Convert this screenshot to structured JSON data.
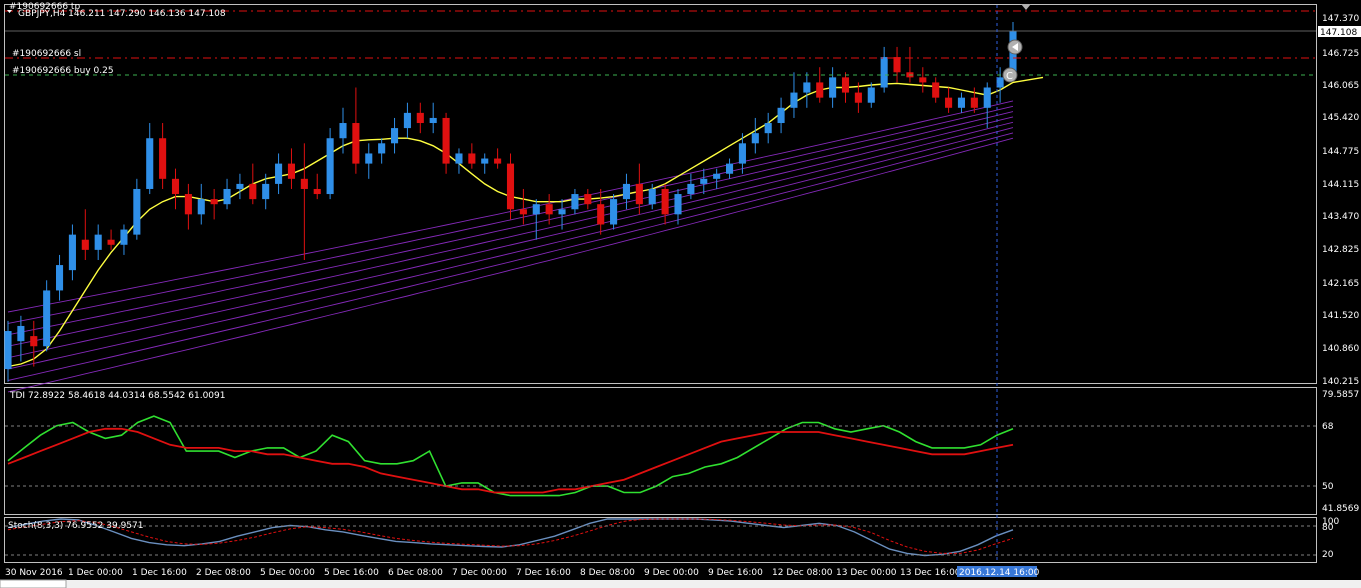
{
  "header": {
    "symbol_line": "GBPJPY,H4  146.211 147.290 146.136 147.108",
    "order_tp": "#190692666 tp",
    "order_sl": "#190692666 sl",
    "order_buy": "#190692666 buy 0.25"
  },
  "main_panel": {
    "price_ticks": [
      "147.370",
      "146.725",
      "146.065",
      "145.420",
      "144.775",
      "144.115",
      "143.470",
      "142.825",
      "142.165",
      "141.520",
      "140.860",
      "140.215"
    ],
    "current_price_label": "147.108"
  },
  "tdi_panel": {
    "label": "TDI 72.8922 58.4618 44.0314 68.5542 61.0091",
    "ticks": [
      "79.5857",
      "68",
      "50",
      "41.8569"
    ]
  },
  "stoch_panel": {
    "label": "Stoch(8,3,3) 76.9552 39.9571",
    "ticks": [
      "100",
      "80",
      "20"
    ]
  },
  "time_axis": {
    "labels": [
      "30 Nov 2016",
      "1 Dec 00:00",
      "1 Dec 16:00",
      "2 Dec 08:00",
      "5 Dec 00:00",
      "5 Dec 16:00",
      "6 Dec 08:00",
      "7 Dec 00:00",
      "7 Dec 16:00",
      "8 Dec 08:00",
      "9 Dec 00:00",
      "9 Dec 16:00",
      "12 Dec 08:00",
      "13 Dec 00:00",
      "13 Dec 16:00"
    ],
    "crosshair_label": "2016.12.14 16:00"
  },
  "colors": {
    "bull": "#2f8fe8",
    "bear": "#e01010",
    "ema": "#ffff40",
    "bands": "#9b30d8",
    "tdi_green": "#30e030",
    "tdi_red": "#e01010",
    "stoch_main": "#6a8fbf",
    "stoch_signal": "#e01010",
    "sl_line": "#e01010",
    "entry_line": "#3cb050"
  },
  "chart_data": {
    "type": "candlestick",
    "symbol": "GBPJPY",
    "timeframe": "H4",
    "ylim": [
      140.215,
      147.6
    ],
    "open_last": 146.211,
    "high_last": 147.29,
    "low_last": 146.136,
    "close_last": 147.108,
    "sl_price": 146.62,
    "entry_price": 146.2,
    "candles": [
      {
        "o": 140.45,
        "h": 141.4,
        "l": 140.2,
        "c": 141.2
      },
      {
        "o": 141.0,
        "h": 141.5,
        "l": 140.6,
        "c": 141.3
      },
      {
        "o": 141.1,
        "h": 141.4,
        "l": 140.5,
        "c": 140.9
      },
      {
        "o": 140.9,
        "h": 142.2,
        "l": 140.8,
        "c": 142.0
      },
      {
        "o": 142.0,
        "h": 142.7,
        "l": 141.8,
        "c": 142.5
      },
      {
        "o": 142.4,
        "h": 143.3,
        "l": 142.2,
        "c": 143.1
      },
      {
        "o": 143.0,
        "h": 143.6,
        "l": 142.6,
        "c": 142.8
      },
      {
        "o": 142.8,
        "h": 143.3,
        "l": 142.6,
        "c": 143.1
      },
      {
        "o": 143.0,
        "h": 143.2,
        "l": 142.8,
        "c": 142.9
      },
      {
        "o": 142.9,
        "h": 143.3,
        "l": 142.7,
        "c": 143.2
      },
      {
        "o": 143.1,
        "h": 144.2,
        "l": 143.0,
        "c": 144.0
      },
      {
        "o": 144.0,
        "h": 145.3,
        "l": 143.9,
        "c": 145.0
      },
      {
        "o": 145.0,
        "h": 145.3,
        "l": 144.0,
        "c": 144.2
      },
      {
        "o": 144.2,
        "h": 144.4,
        "l": 143.6,
        "c": 143.9
      },
      {
        "o": 143.9,
        "h": 144.1,
        "l": 143.2,
        "c": 143.5
      },
      {
        "o": 143.5,
        "h": 144.1,
        "l": 143.3,
        "c": 143.8
      },
      {
        "o": 143.8,
        "h": 144.0,
        "l": 143.4,
        "c": 143.7
      },
      {
        "o": 143.7,
        "h": 144.2,
        "l": 143.6,
        "c": 144.0
      },
      {
        "o": 144.0,
        "h": 144.3,
        "l": 143.8,
        "c": 144.1
      },
      {
        "o": 144.1,
        "h": 144.5,
        "l": 143.7,
        "c": 143.8
      },
      {
        "o": 143.8,
        "h": 144.3,
        "l": 143.6,
        "c": 144.1
      },
      {
        "o": 144.1,
        "h": 144.7,
        "l": 143.9,
        "c": 144.5
      },
      {
        "o": 144.5,
        "h": 144.8,
        "l": 144.0,
        "c": 144.2
      },
      {
        "o": 144.2,
        "h": 144.9,
        "l": 142.6,
        "c": 144.0
      },
      {
        "o": 144.0,
        "h": 144.3,
        "l": 143.8,
        "c": 143.9
      },
      {
        "o": 143.9,
        "h": 145.2,
        "l": 143.8,
        "c": 145.0
      },
      {
        "o": 145.0,
        "h": 145.6,
        "l": 144.7,
        "c": 145.3
      },
      {
        "o": 145.3,
        "h": 146.0,
        "l": 144.3,
        "c": 144.5
      },
      {
        "o": 144.5,
        "h": 144.9,
        "l": 144.2,
        "c": 144.7
      },
      {
        "o": 144.7,
        "h": 145.0,
        "l": 144.5,
        "c": 144.9
      },
      {
        "o": 144.9,
        "h": 145.4,
        "l": 144.7,
        "c": 145.2
      },
      {
        "o": 145.2,
        "h": 145.7,
        "l": 145.0,
        "c": 145.5
      },
      {
        "o": 145.5,
        "h": 145.7,
        "l": 145.1,
        "c": 145.3
      },
      {
        "o": 145.3,
        "h": 145.7,
        "l": 145.1,
        "c": 145.4
      },
      {
        "o": 145.4,
        "h": 145.5,
        "l": 144.3,
        "c": 144.5
      },
      {
        "o": 144.5,
        "h": 144.8,
        "l": 144.3,
        "c": 144.7
      },
      {
        "o": 144.7,
        "h": 144.9,
        "l": 144.4,
        "c": 144.5
      },
      {
        "o": 144.5,
        "h": 144.7,
        "l": 144.3,
        "c": 144.6
      },
      {
        "o": 144.6,
        "h": 144.8,
        "l": 144.4,
        "c": 144.5
      },
      {
        "o": 144.5,
        "h": 144.7,
        "l": 143.4,
        "c": 143.6
      },
      {
        "o": 143.6,
        "h": 144.0,
        "l": 143.3,
        "c": 143.5
      },
      {
        "o": 143.5,
        "h": 143.8,
        "l": 143.0,
        "c": 143.7
      },
      {
        "o": 143.7,
        "h": 143.9,
        "l": 143.3,
        "c": 143.5
      },
      {
        "o": 143.5,
        "h": 143.8,
        "l": 143.2,
        "c": 143.6
      },
      {
        "o": 143.6,
        "h": 144.0,
        "l": 143.5,
        "c": 143.9
      },
      {
        "o": 143.9,
        "h": 144.0,
        "l": 143.6,
        "c": 143.7
      },
      {
        "o": 143.7,
        "h": 144.0,
        "l": 143.1,
        "c": 143.3
      },
      {
        "o": 143.3,
        "h": 143.9,
        "l": 143.2,
        "c": 143.8
      },
      {
        "o": 143.8,
        "h": 144.3,
        "l": 143.6,
        "c": 144.1
      },
      {
        "o": 144.1,
        "h": 144.5,
        "l": 143.5,
        "c": 143.7
      },
      {
        "o": 143.7,
        "h": 144.1,
        "l": 143.6,
        "c": 144.0
      },
      {
        "o": 144.0,
        "h": 144.1,
        "l": 143.3,
        "c": 143.5
      },
      {
        "o": 143.5,
        "h": 144.0,
        "l": 143.3,
        "c": 143.9
      },
      {
        "o": 143.9,
        "h": 144.3,
        "l": 143.8,
        "c": 144.1
      },
      {
        "o": 144.1,
        "h": 144.4,
        "l": 143.9,
        "c": 144.2
      },
      {
        "o": 144.2,
        "h": 144.4,
        "l": 144.0,
        "c": 144.3
      },
      {
        "o": 144.3,
        "h": 144.6,
        "l": 144.2,
        "c": 144.5
      },
      {
        "o": 144.5,
        "h": 145.1,
        "l": 144.3,
        "c": 144.9
      },
      {
        "o": 144.9,
        "h": 145.4,
        "l": 144.7,
        "c": 145.1
      },
      {
        "o": 145.1,
        "h": 145.5,
        "l": 144.9,
        "c": 145.3
      },
      {
        "o": 145.3,
        "h": 145.8,
        "l": 145.1,
        "c": 145.6
      },
      {
        "o": 145.6,
        "h": 146.3,
        "l": 145.4,
        "c": 145.9
      },
      {
        "o": 145.9,
        "h": 146.3,
        "l": 145.6,
        "c": 146.1
      },
      {
        "o": 146.1,
        "h": 146.4,
        "l": 145.7,
        "c": 145.8
      },
      {
        "o": 145.8,
        "h": 146.4,
        "l": 145.6,
        "c": 146.2
      },
      {
        "o": 146.2,
        "h": 146.3,
        "l": 145.7,
        "c": 145.9
      },
      {
        "o": 145.9,
        "h": 146.1,
        "l": 145.5,
        "c": 145.7
      },
      {
        "o": 145.7,
        "h": 146.1,
        "l": 145.6,
        "c": 146.0
      },
      {
        "o": 146.0,
        "h": 146.8,
        "l": 145.9,
        "c": 146.6
      },
      {
        "o": 146.6,
        "h": 146.8,
        "l": 146.1,
        "c": 146.3
      },
      {
        "o": 146.3,
        "h": 146.8,
        "l": 146.1,
        "c": 146.2
      },
      {
        "o": 146.2,
        "h": 146.4,
        "l": 145.9,
        "c": 146.1
      },
      {
        "o": 146.1,
        "h": 146.2,
        "l": 145.7,
        "c": 145.8
      },
      {
        "o": 145.8,
        "h": 146.0,
        "l": 145.5,
        "c": 145.6
      },
      {
        "o": 145.6,
        "h": 145.9,
        "l": 145.5,
        "c": 145.8
      },
      {
        "o": 145.8,
        "h": 146.0,
        "l": 145.5,
        "c": 145.6
      },
      {
        "o": 145.6,
        "h": 146.1,
        "l": 145.2,
        "c": 146.0
      },
      {
        "o": 146.0,
        "h": 146.4,
        "l": 145.7,
        "c": 146.2
      },
      {
        "o": 146.211,
        "h": 147.29,
        "l": 146.136,
        "c": 147.108
      }
    ],
    "ema": [
      140.5,
      140.55,
      140.65,
      140.85,
      141.2,
      141.6,
      142.0,
      142.4,
      142.75,
      143.05,
      143.35,
      143.6,
      143.75,
      143.85,
      143.85,
      143.8,
      143.75,
      143.8,
      143.95,
      144.1,
      144.2,
      144.25,
      144.3,
      144.4,
      144.55,
      144.7,
      144.85,
      144.95,
      144.97,
      144.98,
      145.0,
      145.0,
      144.95,
      144.85,
      144.7,
      144.5,
      144.3,
      144.1,
      143.95,
      143.85,
      143.8,
      143.75,
      143.75,
      143.75,
      143.8,
      143.8,
      143.82,
      143.85,
      143.9,
      143.95,
      144.0,
      144.1,
      144.25,
      144.4,
      144.55,
      144.7,
      144.85,
      145.0,
      145.15,
      145.3,
      145.5,
      145.7,
      145.85,
      145.95,
      146.0,
      146.0,
      146.02,
      146.05,
      146.07,
      146.08,
      146.06,
      146.04,
      146.02,
      146.0,
      145.95,
      145.9,
      145.85,
      145.95,
      146.1
    ],
    "tdi": {
      "green": [
        58,
        62,
        66,
        69,
        70,
        67,
        65,
        66,
        70,
        72,
        70,
        61,
        61,
        61,
        59,
        61,
        62,
        62,
        59,
        61,
        66,
        64,
        58,
        57,
        57,
        58,
        61,
        50,
        51,
        51,
        48,
        47,
        47,
        47,
        47,
        48,
        50,
        50,
        48,
        48,
        50,
        53,
        54,
        56,
        57,
        59,
        62,
        65,
        68,
        70,
        70,
        68,
        67,
        68,
        69,
        67,
        64,
        62,
        62,
        62,
        63,
        66,
        68
      ],
      "red": [
        57,
        59,
        61,
        63,
        65,
        67,
        68,
        68,
        67,
        65,
        63,
        62,
        62,
        62,
        61,
        61,
        60,
        60,
        59,
        58,
        57,
        57,
        56,
        54,
        53,
        52,
        51,
        50,
        49,
        49,
        48,
        48,
        48,
        48,
        49,
        49,
        50,
        51,
        52,
        54,
        56,
        58,
        60,
        62,
        64,
        65,
        66,
        67,
        67,
        67,
        67,
        66,
        65,
        64,
        63,
        62,
        61,
        60,
        60,
        60,
        61,
        62,
        63
      ]
    },
    "stoch": {
      "main": [
        80,
        88,
        95,
        100,
        98,
        85,
        70,
        55,
        45,
        40,
        38,
        42,
        48,
        60,
        70,
        80,
        85,
        82,
        75,
        70,
        62,
        55,
        48,
        45,
        42,
        40,
        38,
        36,
        35,
        40,
        50,
        60,
        75,
        90,
        100,
        100,
        100,
        100,
        100,
        100,
        98,
        95,
        90,
        85,
        80,
        85,
        90,
        85,
        70,
        50,
        30,
        20,
        15,
        18,
        25,
        40,
        60,
        75
      ],
      "signal": [
        75,
        82,
        88,
        94,
        96,
        92,
        82,
        70,
        58,
        48,
        42,
        41,
        44,
        50,
        58,
        68,
        77,
        82,
        80,
        76,
        70,
        62,
        55,
        50,
        46,
        43,
        41,
        39,
        37,
        38,
        42,
        50,
        60,
        72,
        85,
        95,
        99,
        100,
        100,
        100,
        99,
        97,
        94,
        90,
        86,
        84,
        86,
        86,
        80,
        68,
        50,
        35,
        25,
        20,
        20,
        28,
        42,
        55
      ]
    }
  }
}
